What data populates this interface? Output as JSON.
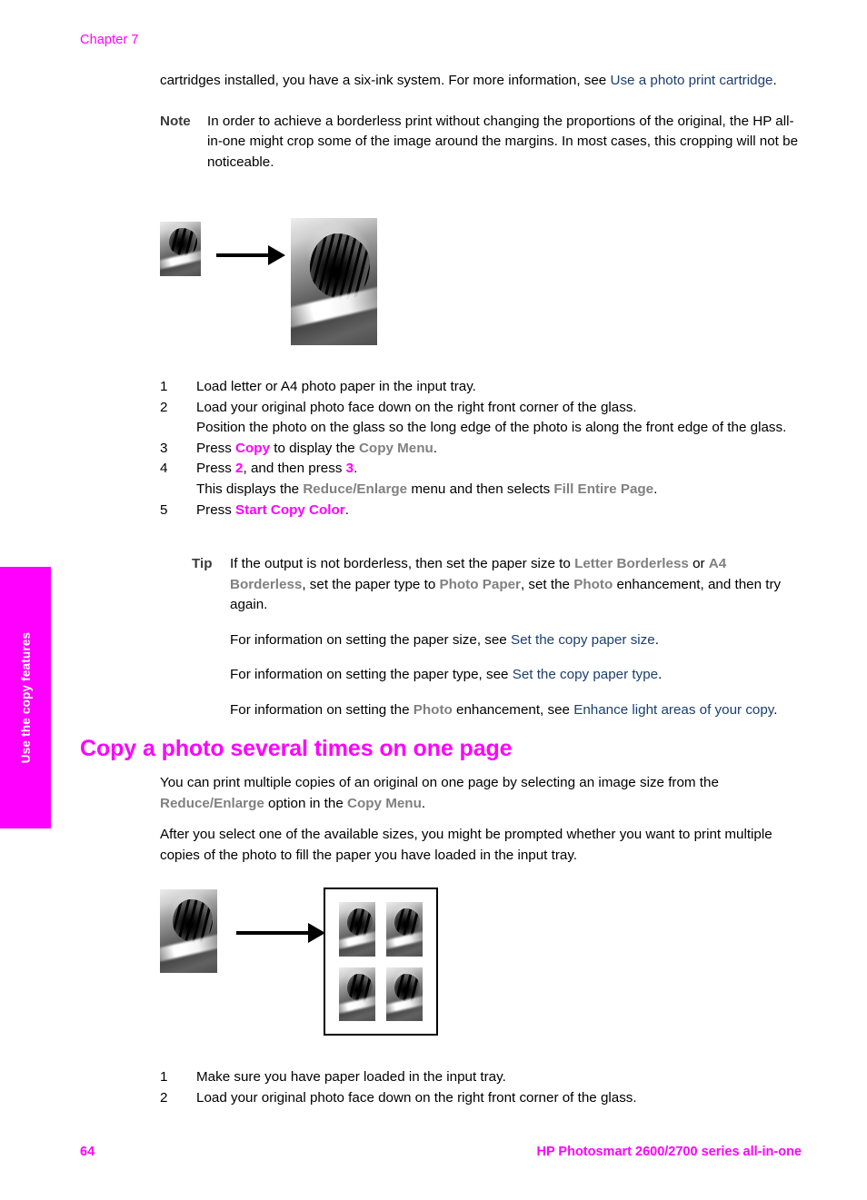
{
  "header": {
    "chapter": "Chapter 7"
  },
  "side_tab": {
    "label": "Use the copy features",
    "background_color": "#ff00ff",
    "text_color": "#ffffff"
  },
  "colors": {
    "accent_magenta": "#ff00ff",
    "link_blue": "#1b3f6e",
    "ui_term_gray": "#808080",
    "body_black": "#000000"
  },
  "intro_paragraph": {
    "text_before_link": "cartridges installed, you have a six-ink system. For more information, see ",
    "link": "Use a photo print cartridge",
    "text_after_link": "."
  },
  "note_block": {
    "label": "Note",
    "text": "In order to achieve a borderless print without changing the proportions of the original, the HP all-in-one might crop some of the image around the margins. In most cases, this cropping will not be noticeable."
  },
  "figure_borderless": {
    "alt": "A small photo is enlarged to fill the entire page",
    "source_image": "tiger-photo-small",
    "arrow": "right-arrow",
    "result_image": "tiger-photo-enlarged"
  },
  "procedure_borderless": {
    "steps": [
      {
        "number": "1",
        "lines": [
          {
            "parts": [
              {
                "text": "Load letter or A4 photo paper in the input tray.",
                "style": "plain"
              }
            ]
          }
        ]
      },
      {
        "number": "2",
        "lines": [
          {
            "parts": [
              {
                "text": "Load your original photo face down on the right front corner of the glass.",
                "style": "plain"
              }
            ]
          },
          {
            "parts": [
              {
                "text": "Position the photo on the glass so the long edge of the photo is along the front edge of the glass.",
                "style": "plain"
              }
            ]
          }
        ]
      },
      {
        "number": "3",
        "lines": [
          {
            "parts": [
              {
                "text": "Press ",
                "style": "plain"
              },
              {
                "text": "Copy",
                "style": "key"
              },
              {
                "text": " to display the ",
                "style": "plain"
              },
              {
                "text": "Copy Menu",
                "style": "ui"
              },
              {
                "text": ".",
                "style": "plain"
              }
            ]
          }
        ]
      },
      {
        "number": "4",
        "lines": [
          {
            "parts": [
              {
                "text": "Press ",
                "style": "plain"
              },
              {
                "text": "2",
                "style": "key"
              },
              {
                "text": ", and then press ",
                "style": "plain"
              },
              {
                "text": "3",
                "style": "key"
              },
              {
                "text": ".",
                "style": "plain"
              }
            ]
          },
          {
            "parts": [
              {
                "text": "This displays the ",
                "style": "plain"
              },
              {
                "text": "Reduce/Enlarge",
                "style": "ui"
              },
              {
                "text": " menu and then selects ",
                "style": "plain"
              },
              {
                "text": "Fill Entire Page",
                "style": "ui"
              },
              {
                "text": ".",
                "style": "plain"
              }
            ]
          }
        ]
      },
      {
        "number": "5",
        "lines": [
          {
            "parts": [
              {
                "text": "Press ",
                "style": "plain"
              },
              {
                "text": "Start Copy Color",
                "style": "key"
              },
              {
                "text": ".",
                "style": "plain"
              }
            ]
          }
        ]
      }
    ]
  },
  "tip_block": {
    "label": "Tip",
    "paragraph_1": {
      "parts": [
        {
          "text": "If the output is not borderless, then set the paper size to ",
          "style": "plain"
        },
        {
          "text": "Letter Borderless",
          "style": "ui"
        },
        {
          "text": " or ",
          "style": "plain"
        },
        {
          "text": "A4 Borderless",
          "style": "ui"
        },
        {
          "text": ", set the paper type to ",
          "style": "plain"
        },
        {
          "text": "Photo Paper",
          "style": "ui"
        },
        {
          "text": ", set the ",
          "style": "plain"
        },
        {
          "text": "Photo",
          "style": "ui"
        },
        {
          "text": " enhancement, and then try again.",
          "style": "plain"
        }
      ]
    },
    "paragraph_2": {
      "parts": [
        {
          "text": "For information on setting the paper size, see ",
          "style": "plain"
        },
        {
          "text": "Set the copy paper size",
          "style": "link"
        },
        {
          "text": ".",
          "style": "plain"
        }
      ]
    },
    "paragraph_3": {
      "parts": [
        {
          "text": "For information on setting the paper type, see ",
          "style": "plain"
        },
        {
          "text": "Set the copy paper type",
          "style": "link"
        },
        {
          "text": ".",
          "style": "plain"
        }
      ]
    },
    "paragraph_4": {
      "parts": [
        {
          "text": "For information on setting the ",
          "style": "plain"
        },
        {
          "text": "Photo",
          "style": "ui"
        },
        {
          "text": " enhancement, see ",
          "style": "plain"
        },
        {
          "text": "Enhance light areas of your copy",
          "style": "link"
        },
        {
          "text": ".",
          "style": "plain"
        }
      ]
    }
  },
  "section": {
    "title": "Copy a photo several times on one page",
    "paragraph_1": {
      "parts": [
        {
          "text": "You can print multiple copies of an original on one page by selecting an image size from the ",
          "style": "plain"
        },
        {
          "text": "Reduce/Enlarge",
          "style": "ui"
        },
        {
          "text": " option in the ",
          "style": "plain"
        },
        {
          "text": "Copy Menu",
          "style": "ui"
        },
        {
          "text": ".",
          "style": "plain"
        }
      ]
    },
    "paragraph_2": {
      "parts": [
        {
          "text": "After you select one of the available sizes, you might be prompted whether you want to print multiple copies of the photo to fill the paper you have loaded in the input tray.",
          "style": "plain"
        }
      ]
    }
  },
  "figure_multiple": {
    "alt": "One photo becomes four copies arranged on a single sheet",
    "source_image": "tiger-photo",
    "arrow": "right-arrow",
    "result_sheet": {
      "copies": 4,
      "layout": "2x2"
    }
  },
  "procedure_multiple": {
    "steps": [
      {
        "number": "1",
        "text": "Make sure you have paper loaded in the input tray."
      },
      {
        "number": "2",
        "text": "Load your original photo face down on the right front corner of the glass."
      }
    ]
  },
  "footer": {
    "page_number": "64",
    "product": "HP Photosmart 2600/2700 series all-in-one"
  }
}
